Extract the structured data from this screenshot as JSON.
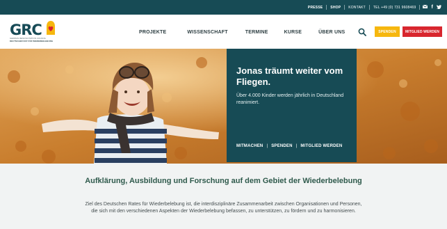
{
  "topbar": {
    "links": [
      "PRESSE",
      "SHOP",
      "KONTAKT",
      "TEL +49 (0) 731 9608469"
    ],
    "icons": [
      "mail-icon",
      "facebook-icon",
      "twitter-icon"
    ],
    "icon_glyphs": [
      "✉",
      "f",
      "🐦"
    ]
  },
  "logo": {
    "text": "GRC",
    "sub1": "GERMAN RESUSCITATION COUNCIL",
    "sub2": "DEUTSCHER RAT FÜR WIEDERBELEBUNG"
  },
  "nav": {
    "items": [
      "PROJEKTE",
      "WISSENSCHAFT",
      "TERMINE",
      "KURSE",
      "ÜBER UNS"
    ]
  },
  "header": {
    "spenden_label": "SPENDEN",
    "mitglied_label": "MITGLIED WERDEN"
  },
  "hero": {
    "title": "Jonas träumt weiter vom Fliegen.",
    "text": "Über 4.000 Kinder werden jährlich in Deutschland reanimiert.",
    "links": [
      "MITMACHEN",
      "SPENDEN",
      "MITGLIED WERDEN"
    ],
    "separator": "|"
  },
  "intro": {
    "title": "Aufklärung, Ausbildung und Forschung auf dem Gebiet der Wiederbelebung",
    "text": "Ziel des Deutschen Rates für Wiederbelebung ist, die interdisziplinäre Zusammenarbeit zwischen Organisationen und Personen, die sich mit den verschiedenen Aspekten der Wiederbelebung befassen, zu unterstützen, zu fördern und zu harmonisieren."
  },
  "colors": {
    "primary": "#174b55",
    "yellow": "#f6b70e",
    "red": "#d8262e",
    "intro_bg": "#f1f3f3"
  }
}
